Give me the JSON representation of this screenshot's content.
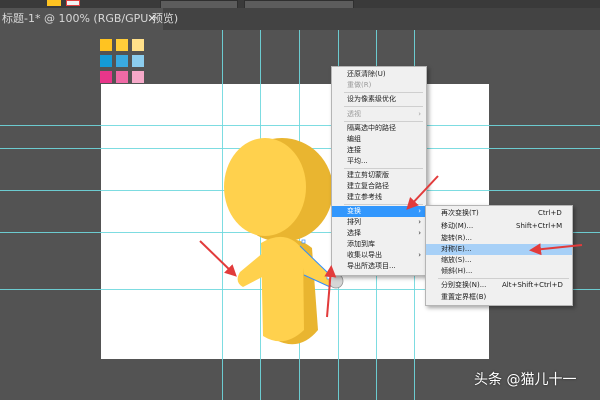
{
  "document_tab": {
    "title": "标题-1* @ 100% (RGB/GPU 预览)",
    "close_glyph": "✕"
  },
  "swatch_colors": [
    "#ffc321",
    "#ffce3a",
    "#ffe08a",
    "#149bd6",
    "#3aaae0",
    "#8ccdee",
    "#e8368a",
    "#ef6aa6",
    "#f6a9c9"
  ],
  "character_colors": {
    "face": "#ffd14d",
    "side": "#e9b530"
  },
  "context_menu": {
    "items": [
      {
        "label": "还原清除(U)",
        "state": "normal"
      },
      {
        "label": "重做(R)",
        "state": "disabled"
      },
      {
        "label": "设为像素级优化",
        "state": "normal"
      },
      {
        "label": "透视",
        "state": "disabled",
        "submenu": true
      },
      {
        "label": "隔离选中的路径",
        "state": "normal"
      },
      {
        "label": "编组",
        "state": "normal"
      },
      {
        "label": "连接",
        "state": "normal"
      },
      {
        "label": "平均...",
        "state": "normal"
      },
      {
        "label": "建立剪切蒙版",
        "state": "normal"
      },
      {
        "label": "建立复合路径",
        "state": "normal"
      },
      {
        "label": "建立参考线",
        "state": "normal"
      },
      {
        "label": "变换",
        "state": "active",
        "submenu": true
      },
      {
        "label": "排列",
        "state": "normal",
        "submenu": true
      },
      {
        "label": "选择",
        "state": "normal",
        "submenu": true
      },
      {
        "label": "添加到库",
        "state": "normal"
      },
      {
        "label": "收集以导出",
        "state": "normal",
        "submenu": true
      },
      {
        "label": "导出所选项目...",
        "state": "normal"
      }
    ]
  },
  "transform_submenu": {
    "items": [
      {
        "label": "再次变换(T)",
        "shortcut": "Ctrl+D",
        "state": "normal"
      },
      {
        "label": "移动(M)...",
        "shortcut": "Shift+Ctrl+M",
        "state": "normal"
      },
      {
        "label": "旋转(R)...",
        "shortcut": "",
        "state": "normal"
      },
      {
        "label": "对称(E)...",
        "shortcut": "",
        "state": "hover"
      },
      {
        "label": "缩放(S)...",
        "shortcut": "",
        "state": "normal"
      },
      {
        "label": "倾斜(H)...",
        "shortcut": "",
        "state": "normal"
      },
      {
        "label": "分别变换(N)...",
        "shortcut": "Alt+Shift+Ctrl+D",
        "state": "normal"
      },
      {
        "label": "重置定界框(B)",
        "shortcut": "",
        "state": "normal"
      }
    ]
  },
  "watermark": "头条 @猫儿十一",
  "submenu_arrow_glyph": "›"
}
